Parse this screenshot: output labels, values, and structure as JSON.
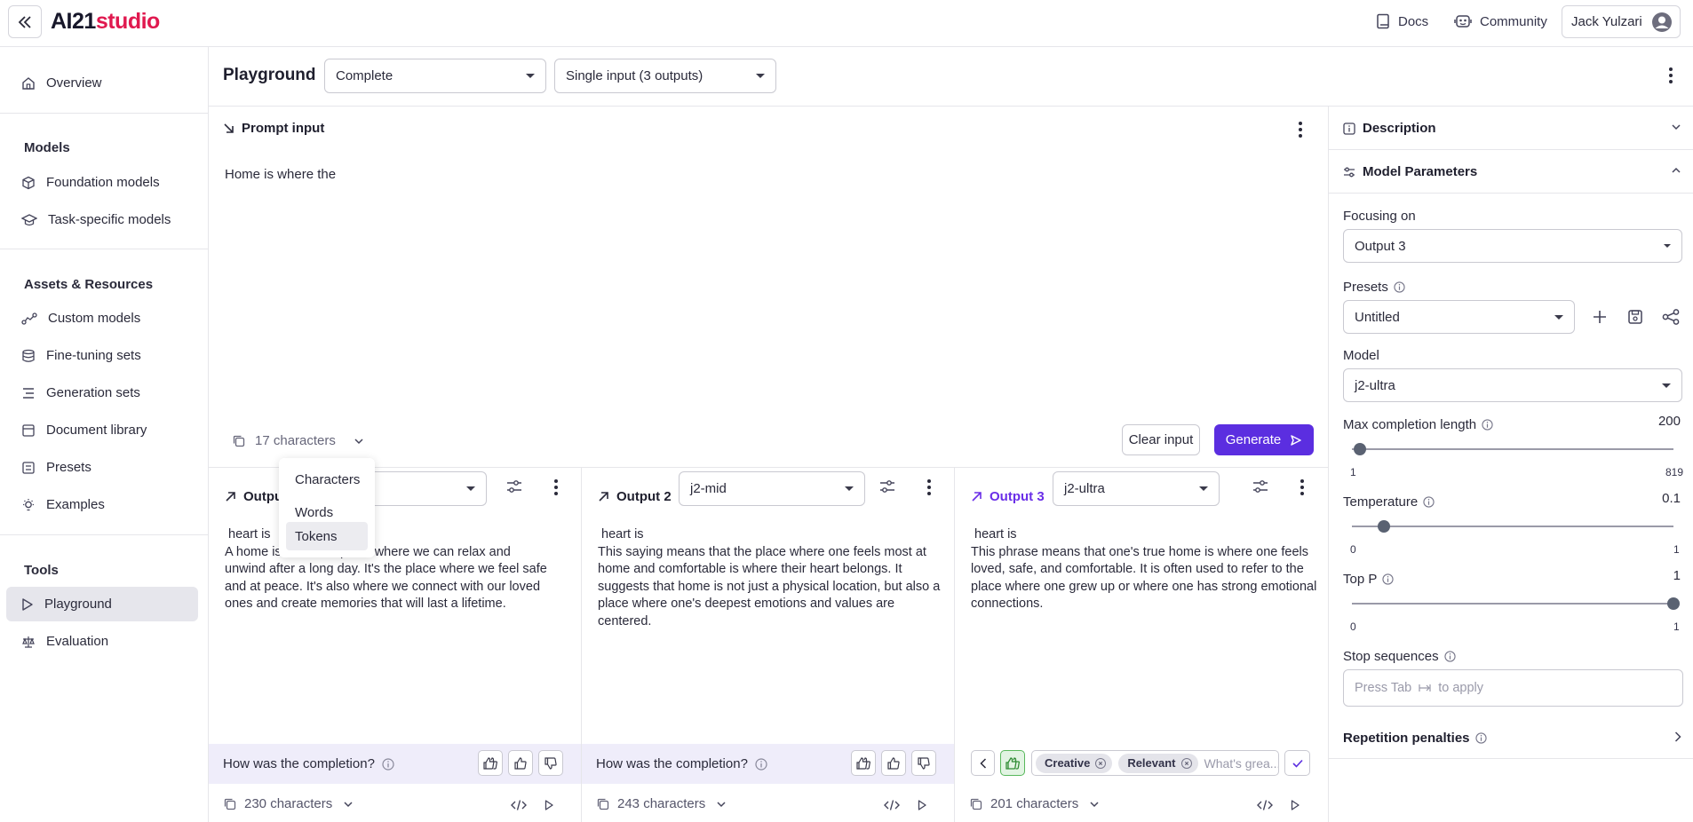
{
  "app": {
    "logo_main": "AI21",
    "logo_accent": "studio"
  },
  "topbar": {
    "docs": "Docs",
    "community": "Community",
    "user": "Jack Yulzari"
  },
  "sidebar": {
    "overview": "Overview",
    "models_heading": "Models",
    "foundation": "Foundation models",
    "task_specific": "Task-specific models",
    "assets_heading": "Assets & Resources",
    "custom_models": "Custom models",
    "fine_tuning": "Fine-tuning sets",
    "generation_sets": "Generation sets",
    "document_library": "Document library",
    "presets": "Presets",
    "examples": "Examples",
    "tools_heading": "Tools",
    "playground": "Playground",
    "evaluation": "Evaluation"
  },
  "header": {
    "title": "Playground",
    "mode": "Complete",
    "input_mode": "Single input (3 outputs)"
  },
  "prompt": {
    "title": "Prompt input",
    "text": "Home is where the",
    "count": "17 characters",
    "clear": "Clear input",
    "generate": "Generate"
  },
  "count_menu": {
    "items": [
      "Characters",
      "Words",
      "Tokens"
    ],
    "highlighted": "Tokens"
  },
  "outputs": [
    {
      "title": "Outpu",
      "model": "",
      "prefix": "heart is",
      "line1_end": "place where we can relax and",
      "line1_start": "A home is",
      "line2_start": "unwind afte",
      "line2_end": "r a long day. It's the place where we feel safe",
      "line3": "and at peace. It's also where we connect with our loved",
      "line4": "ones and create memories that will last a lifetime.",
      "feedback": "How was the completion?",
      "count": "230 characters"
    },
    {
      "title": "Output 2",
      "model": "j2-mid",
      "prefix": "heart is",
      "text": "This saying means that the place where one feels most at home and comfortable is where their heart belongs. It suggests that home is not just a physical location, but also a place where one's deepest emotions and values are centered.",
      "feedback": "How was the completion?",
      "count": "243 characters"
    },
    {
      "title": "Output 3",
      "model": "j2-ultra",
      "prefix": "heart is",
      "text": "This phrase means that one's true home is where one feels loved, safe, and comfortable. It is often used to refer to the place where one grew up or where one has strong emotional connections.",
      "tags": [
        "Creative",
        "Relevant"
      ],
      "feedback_placeholder": "What's grea...",
      "count": "201 characters"
    }
  ],
  "right_panel": {
    "description": "Description",
    "model_params": "Model Parameters",
    "focusing_label": "Focusing on",
    "focusing_value": "Output 3",
    "presets_label": "Presets",
    "presets_value": "Untitled",
    "model_label": "Model",
    "model_value": "j2-ultra",
    "max_len_label": "Max completion length",
    "max_len_value": "200",
    "max_len_min": "1",
    "max_len_max": "819",
    "max_len_level": 0.024,
    "temp_label": "Temperature",
    "temp_value": "0.1",
    "temp_min": "0",
    "temp_max": "1",
    "temp_level": 0.1,
    "topp_label": "Top P",
    "topp_value": "1",
    "topp_min": "0",
    "topp_max": "1",
    "topp_level": 1.0,
    "stop_label": "Stop sequences",
    "stop_placeholder_a": "Press Tab",
    "stop_placeholder_b": "to apply",
    "repetition": "Repetition penalties"
  },
  "colors": {
    "accent": "#5b2ee0",
    "brand": "#e0194f",
    "output3": "#6a2ee8",
    "feedback_bg": "#efedfa"
  }
}
